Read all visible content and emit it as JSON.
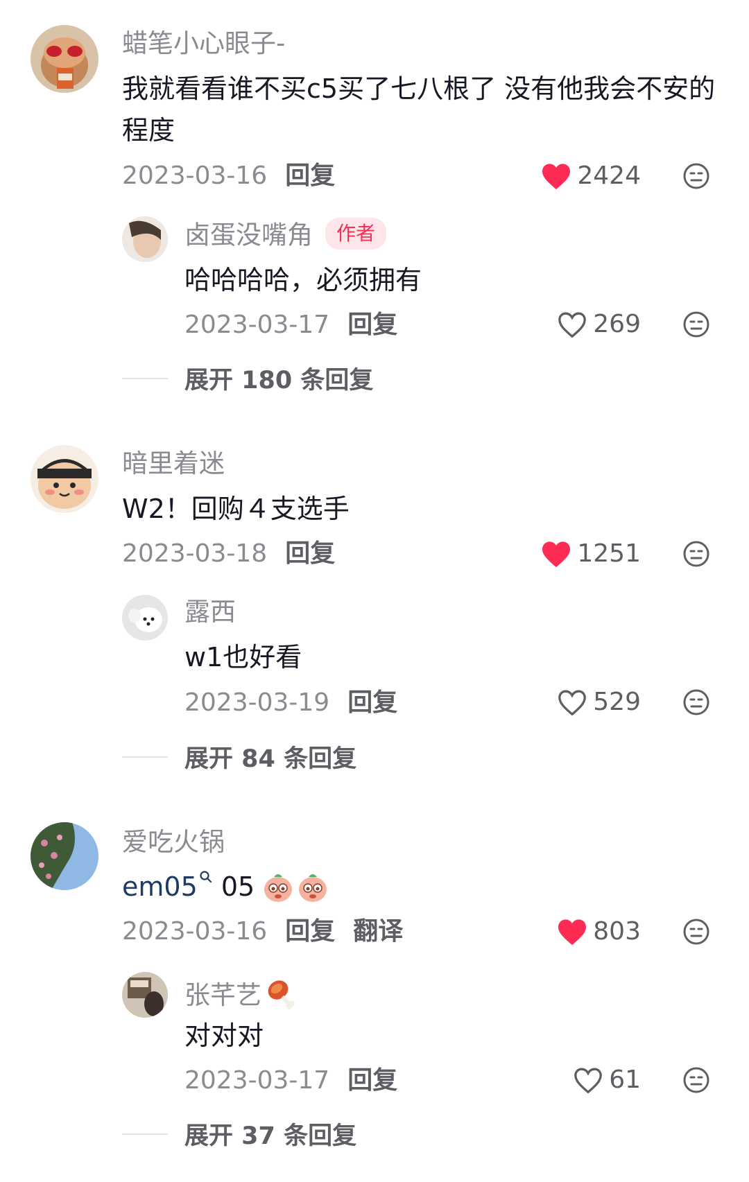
{
  "comments": [
    {
      "username": "蜡笔小心眼子-",
      "text": "我就看看谁不买c5买了七八根了 没有他我会不安的程度",
      "date": "2023-03-16",
      "reply_label": "回复",
      "likes": "2424",
      "liked": true,
      "reply": {
        "username": "卤蛋没嘴角",
        "badge": "作者",
        "text": "哈哈哈哈，必须拥有",
        "date": "2023-03-17",
        "reply_label": "回复",
        "likes": "269",
        "liked": false
      },
      "expand_label": "展开 180 条回复"
    },
    {
      "username": "暗里着迷",
      "text": "W2！回购４支选手",
      "date": "2023-03-18",
      "reply_label": "回复",
      "likes": "1251",
      "liked": true,
      "reply": {
        "username": "露西",
        "text": "w1也好看",
        "date": "2023-03-19",
        "reply_label": "回复",
        "likes": "529",
        "liked": false
      },
      "expand_label": "展开 84 条回复"
    },
    {
      "username": "爱吃火锅",
      "mention": "em05",
      "text": " 05",
      "date": "2023-03-16",
      "reply_label": "回复",
      "translate_label": "翻译",
      "likes": "803",
      "liked": true,
      "reply": {
        "username": "张芊艺",
        "text": "对对对",
        "date": "2023-03-17",
        "reply_label": "回复",
        "likes": "61",
        "liked": false
      },
      "expand_label": "展开 37 条回复"
    }
  ],
  "colors": {
    "like_active": "#fe2c55",
    "muted": "#8a8b91",
    "badge": "#fe2c55"
  },
  "icons": [
    "heart-filled-icon",
    "heart-outline-icon",
    "dislike-face-icon",
    "search-mention-icon",
    "emoji-icon",
    "drumstick-icon"
  ]
}
